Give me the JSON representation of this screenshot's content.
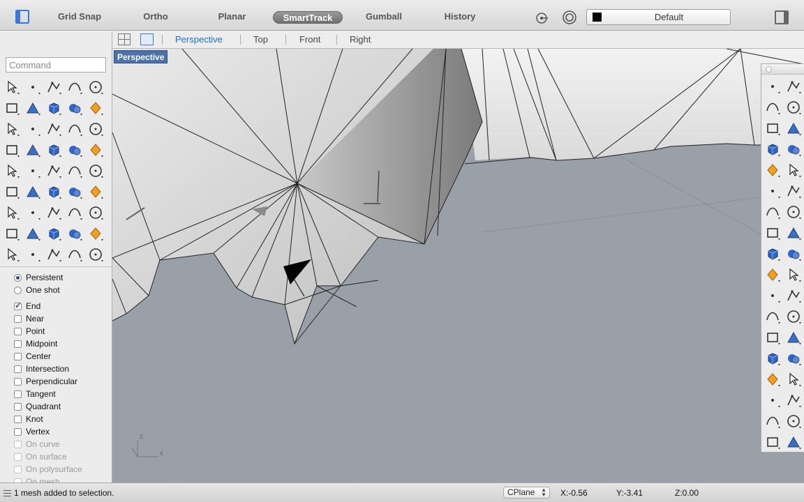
{
  "toolbar": {
    "grid_snap": "Grid Snap",
    "ortho": "Ortho",
    "planar": "Planar",
    "smarttrack": "SmartTrack",
    "gumball": "Gumball",
    "history": "History",
    "layer_name": "Default",
    "layer_color": "#000000"
  },
  "viewport_tabs": {
    "perspective": "Perspective",
    "top": "Top",
    "front": "Front",
    "right": "Right",
    "active_color": "#1d6fd0"
  },
  "command": {
    "placeholder": "Command"
  },
  "osnap": {
    "persistent": "Persistent",
    "one_shot": "One shot",
    "items": [
      {
        "label": "End",
        "checked": true
      },
      {
        "label": "Near",
        "checked": false
      },
      {
        "label": "Point",
        "checked": false
      },
      {
        "label": "Midpoint",
        "checked": false
      },
      {
        "label": "Center",
        "checked": false
      },
      {
        "label": "Intersection",
        "checked": false
      },
      {
        "label": "Perpendicular",
        "checked": false
      },
      {
        "label": "Tangent",
        "checked": false
      },
      {
        "label": "Quadrant",
        "checked": false
      },
      {
        "label": "Knot",
        "checked": false
      },
      {
        "label": "Vertex",
        "checked": false
      },
      {
        "label": "On curve",
        "checked": false,
        "disabled": true
      },
      {
        "label": "On surface",
        "checked": false,
        "disabled": true
      },
      {
        "label": "On polysurface",
        "checked": false,
        "disabled": true
      },
      {
        "label": "On mesh",
        "checked": false,
        "disabled": true
      }
    ]
  },
  "viewport": {
    "label": "Perspective",
    "axis_z": "z",
    "axis_x": "x",
    "background": "#9aa0a8",
    "label_color": "#4c72a8"
  },
  "status": {
    "message": "1 mesh added to selection.",
    "cplane": "CPlane",
    "x": "X:-0.56",
    "y": "Y:-3.41",
    "z": "Z:0.00"
  }
}
